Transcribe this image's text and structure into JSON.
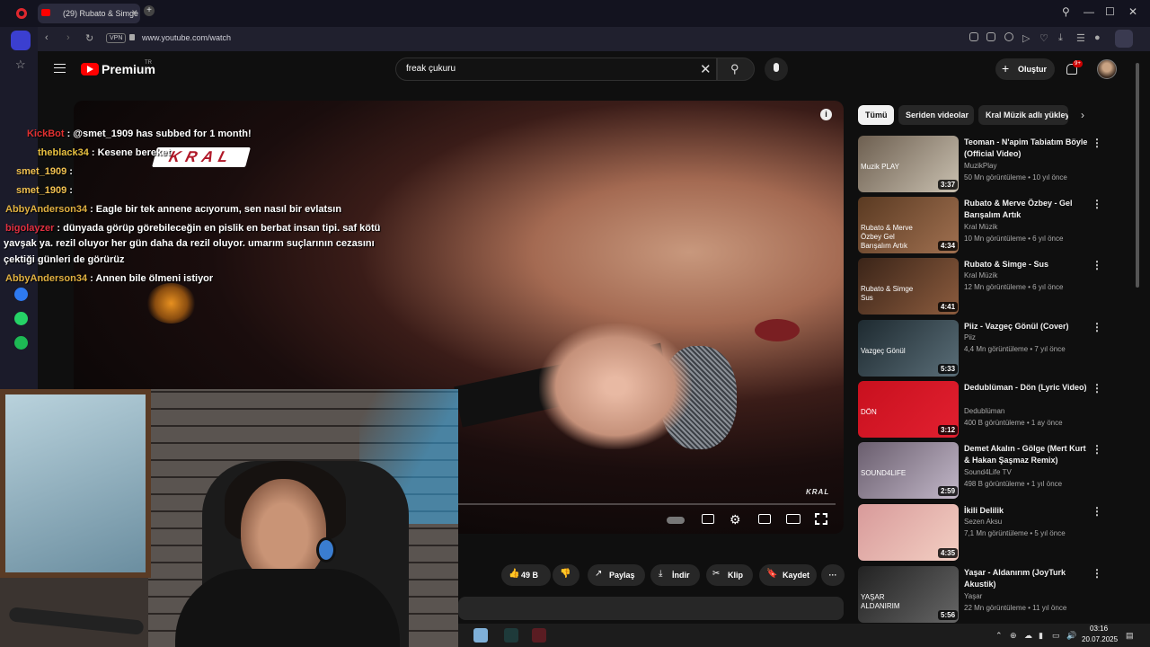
{
  "browser": {
    "tab_title": "(29) Rubato & Simge - Yo",
    "new_tab": "+",
    "vpn": "VPN",
    "url": "www.youtube.com/watch",
    "win_search": "⚲",
    "win_min": "—",
    "win_max": "☐",
    "win_close": "✕"
  },
  "youtube": {
    "logo": "Premium",
    "region": "TR",
    "search_value": "freak çukuru",
    "create_label": "Oluştur",
    "notif_count": "9+",
    "kral_watermark": "KRAL"
  },
  "actions": {
    "likes": "49 B",
    "share": "Paylaş",
    "download": "İndir",
    "clip": "Klip",
    "save": "Kaydet",
    "more": "···"
  },
  "chips": [
    "Tümü",
    "Seriden videolar",
    "Kral Müzik adlı yükleyici"
  ],
  "recommendations": [
    {
      "title": "Teoman - N'apim Tabiatım Böyle (Official Video)",
      "channel": "MuzikPlay",
      "meta": "50 Mn görüntüleme • 10 yıl önce",
      "duration": "3:37",
      "thumb_text": "Muzik PLAY",
      "color1": "#6d5f50",
      "color2": "#c9c0b0"
    },
    {
      "title": "Rubato & Merve Özbey - Gel Barışalım Artık",
      "channel": "Kral Müzik",
      "meta": "10 Mn görüntüleme • 6 yıl önce",
      "duration": "4:34",
      "thumb_text": "Rubato & Merve Özbey Gel Barışalım Artık",
      "color1": "#5a3a22",
      "color2": "#a07050"
    },
    {
      "title": "Rubato & Simge - Sus",
      "channel": "Kral Müzik",
      "meta": "12 Mn görüntüleme • 6 yıl önce",
      "duration": "4:41",
      "thumb_text": "Rubato & Simge Sus",
      "color1": "#3a2418",
      "color2": "#8c5c3e"
    },
    {
      "title": "Piiz - Vazgeç Gönül (Cover)",
      "channel": "Piiz",
      "meta": "4,4 Mn görüntüleme • 7 yıl önce",
      "duration": "5:33",
      "thumb_text": "Vazgeç Gönül",
      "color1": "#1e2a30",
      "color2": "#5a6e78"
    },
    {
      "title": "Dedublüman - Dön (Lyric Video)",
      "channel": "Dedublüman",
      "meta": "400 B görüntüleme • 1 ay önce",
      "duration": "3:12",
      "thumb_text": "DÖN",
      "color1": "#c8101e",
      "color2": "#e22030"
    },
    {
      "title": "Demet Akalın - Gölge (Mert Kurt & Hakan Şaşmaz Remix)",
      "channel": "Sound4Life TV",
      "meta": "498 B görüntüleme • 1 yıl önce",
      "duration": "2:59",
      "thumb_text": "SOUND4LIFE",
      "color1": "#6a5e6e",
      "color2": "#c2b7c8"
    },
    {
      "title": "İkili Delilik",
      "channel": "Sezen Aksu",
      "meta": "7,1 Mn görüntüleme • 5 yıl önce",
      "duration": "4:35",
      "thumb_text": "",
      "color1": "#d89a9a",
      "color2": "#f3cfc3"
    },
    {
      "title": "Yaşar - Aldanırım (JoyTurk Akustik)",
      "channel": "Yaşar",
      "meta": "22 Mn görüntüleme • 11 yıl önce",
      "duration": "5:56",
      "thumb_text": "YAŞAR ALDANIRIM",
      "color1": "#222",
      "color2": "#666"
    }
  ],
  "chat": [
    {
      "name": "KickBot",
      "name_color": "#e03030",
      "message": ": @smet_1909 has subbed for 1 month!"
    },
    {
      "name": "theblack34",
      "name_color": "#e8c040",
      "message": ": Kesene bereket"
    },
    {
      "name": "smet_1909",
      "name_color": "#f0c050",
      "message": ":"
    },
    {
      "name": "smet_1909",
      "name_color": "#f0c050",
      "message": ":"
    },
    {
      "name": "AbbyAnderson34",
      "name_color": "#e0b040",
      "message": ": Eagle bir tek annene acıyorum, sen nasıl bir evlatsın"
    },
    {
      "name": "bigolayzer",
      "name_color": "#e03040",
      "message": ": dünyada görüp görebileceğin en pislik en berbat insan tipi. saf kötü"
    },
    {
      "name": "",
      "name_color": "#fff",
      "message": "yavşak ya. rezil oluyor her gün daha da rezil oluyor. umarım suçlarının cezasını"
    },
    {
      "name": "",
      "name_color": "#fff",
      "message": "çektiği günleri de görürüz"
    },
    {
      "name": "AbbyAnderson34",
      "name_color": "#e0b040",
      "message": ": Annen bile ölmeni istiyor"
    }
  ],
  "taskbar": {
    "time": "03:16",
    "date": "20.07.2025"
  }
}
